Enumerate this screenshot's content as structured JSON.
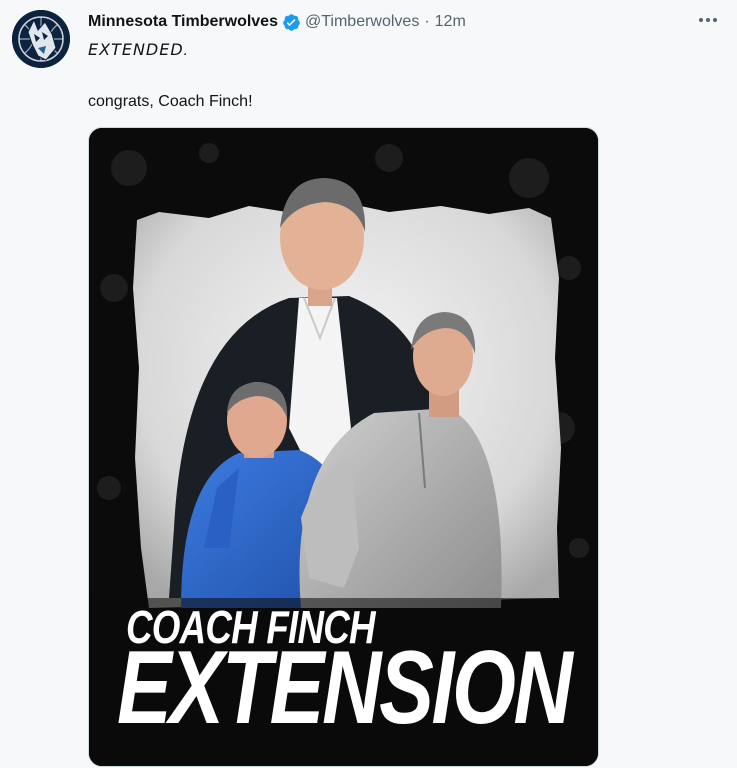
{
  "tweet": {
    "display_name": "Minnesota Timberwolves",
    "handle": "@Timberwolves",
    "separator": "·",
    "time": "12m",
    "line1": "𝘌𝘟𝘛𝘌𝘕𝘋𝘌𝘋.",
    "line2": "congrats, Coach Finch!"
  },
  "media": {
    "headline_line1": "COACH FINCH",
    "headline_line2": "EXTENSION"
  },
  "icons": {
    "avatar": "timberwolves-logo",
    "verified": "verified-badge-icon",
    "more": "more-horizontal-icon"
  },
  "colors": {
    "verified": "#1d9bf0",
    "secondary_text": "#536471",
    "team_navy": "#0c2340",
    "jacket_blue": "#2a5fc4"
  }
}
